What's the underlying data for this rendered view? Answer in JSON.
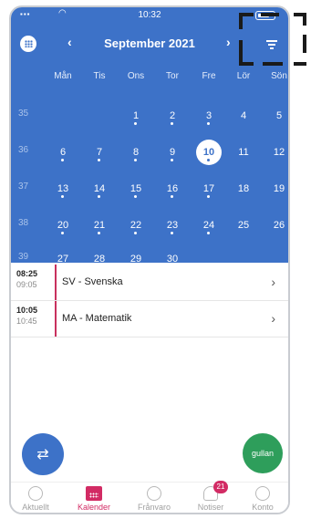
{
  "status_bar": {
    "time": "10:32"
  },
  "header": {
    "month_title": "September 2021",
    "prev_label": "‹",
    "next_label": "›",
    "weekdays": [
      "Mån",
      "Tis",
      "Ons",
      "Tor",
      "Fre",
      "Lör",
      "Sön"
    ]
  },
  "weeks": [
    {
      "week": "35",
      "days": [
        "",
        "",
        "1",
        "2",
        "3",
        "4",
        "5"
      ]
    },
    {
      "week": "36",
      "days": [
        "6",
        "7",
        "8",
        "9",
        "10",
        "11",
        "12"
      ]
    },
    {
      "week": "37",
      "days": [
        "13",
        "14",
        "15",
        "16",
        "17",
        "18",
        "19"
      ]
    },
    {
      "week": "38",
      "days": [
        "20",
        "21",
        "22",
        "23",
        "24",
        "25",
        "26"
      ]
    },
    {
      "week": "39",
      "days": [
        "27",
        "28",
        "29",
        "30",
        "",
        "",
        ""
      ]
    }
  ],
  "today": "10",
  "events": [
    {
      "start": "08:25",
      "end": "09:05",
      "title": "SV - Svenska"
    },
    {
      "start": "10:05",
      "end": "10:45",
      "title": "MA - Matematik"
    }
  ],
  "fab": {
    "swap_label": "⇄",
    "user_label": "gullan"
  },
  "tabs": [
    {
      "label": "Aktuellt",
      "icon": "clock-icon"
    },
    {
      "label": "Kalender",
      "icon": "calendar-icon"
    },
    {
      "label": "Frånvaro",
      "icon": "absence-icon"
    },
    {
      "label": "Notiser",
      "icon": "bell-icon",
      "badge": "21"
    },
    {
      "label": "Konto",
      "icon": "account-icon"
    }
  ],
  "colors": {
    "primary": "#3d72c8",
    "accent": "#d22b64",
    "green": "#2e9e5b",
    "event_bar": "#c8315e"
  }
}
